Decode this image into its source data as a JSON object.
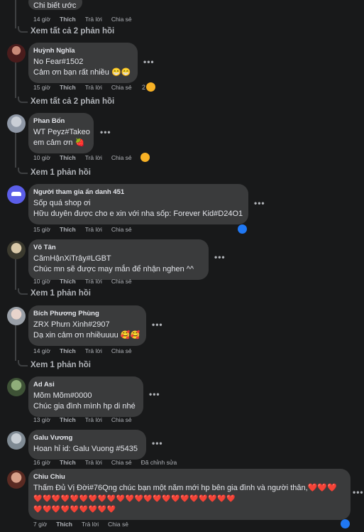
{
  "colors": {
    "background": "#18191a",
    "bubble": "#3a3b3c",
    "text": "#e4e6eb",
    "muted": "#b0b3b8",
    "like_blue": "#2078f4",
    "heart": "#f33e58"
  },
  "top": {
    "partial_text": "Chi biết ước",
    "time": "14 giờ",
    "like": "Thích",
    "reply": "Trả lời",
    "share": "Chia sẻ",
    "view_replies": "Xem tất cả 2 phản hồi"
  },
  "comments": [
    {
      "author": "Huỳnh Nghĩa",
      "lines": [
        "No Fear#1502",
        "Cảm ơn bạn rất nhiều 😁😁"
      ],
      "time": "15 giờ",
      "like": "Thích",
      "reply": "Trả lời",
      "share": "Chia sẻ",
      "reaction_count": "2",
      "reaction": "grin-emoji",
      "view_replies": "Xem tất cả 2 phản hồi"
    },
    {
      "author": "Phan Bốn",
      "lines": [
        "WT Peyz#Takeo",
        "em cảm ơn 🍓"
      ],
      "time": "10 giờ",
      "like": "Thích",
      "reply": "Trả lời",
      "share": "Chia sẻ",
      "reaction": "laugh-emoji",
      "view_replies": "Xem 1 phản hồi"
    },
    {
      "author": "Người tham gia ẩn danh 451",
      "lines": [
        "Sốp quá shop ơi",
        "Hữu duyên được cho e xin với nha sốp: Forever Kid#D24O1"
      ],
      "time": "15 giờ",
      "like": "Thích",
      "reply": "Trả lời",
      "share": "Chia sẻ",
      "reaction": "like-reaction"
    },
    {
      "author": "Võ Tân",
      "lines": [
        "CămHậnXiTrây#LGBT",
        "Chúc mn sẽ được may mắn để nhận nghen ^^"
      ],
      "time": "10 giờ",
      "like": "Thích",
      "reply": "Trả lời",
      "share": "Chia sẻ",
      "view_replies": "Xem 1 phản hồi"
    },
    {
      "author": "Bích Phương Phùng",
      "lines": [
        "ZRX Phưn Xinh#2907",
        "Dạ xin cảm ơn nhiềuuuu 🥰🥰"
      ],
      "time": "14 giờ",
      "like": "Thích",
      "reply": "Trả lời",
      "share": "Chia sẻ",
      "view_replies": "Xem 1 phản hồi"
    },
    {
      "author": "Ad Asi",
      "lines": [
        "Mõm Mõm#0000",
        "Chúc gia đình mình hp di nhé"
      ],
      "time": "13 giờ",
      "like": "Thích",
      "reply": "Trả lời",
      "share": "Chia sẻ"
    },
    {
      "author": "Galu Vương",
      "lines": [
        "Hoan hỉ id: Galu Vuong #5435"
      ],
      "time": "16 giờ",
      "like": "Thích",
      "reply": "Trả lời",
      "share": "Chia sẻ",
      "edited": "Đã chỉnh sửa"
    },
    {
      "author": "Chiu Chiu",
      "lines": [
        "Thấm Đủ Vị Đời#76Qng chúc bạn một năm mới hp bên gia đình và người thân,❤️❤️❤️",
        "❤️❤️❤️❤️❤️❤️❤️❤️❤️❤️❤️❤️❤️❤️❤️❤️❤️❤️❤️❤️❤️❤️",
        "❤️❤️❤️❤️❤️❤️❤️❤️❤️"
      ],
      "time": "7 giờ",
      "like": "Thích",
      "reply": "Trả lời",
      "share": "Chia sẻ",
      "reaction": "like-reaction"
    }
  ],
  "more_icon": "•••"
}
